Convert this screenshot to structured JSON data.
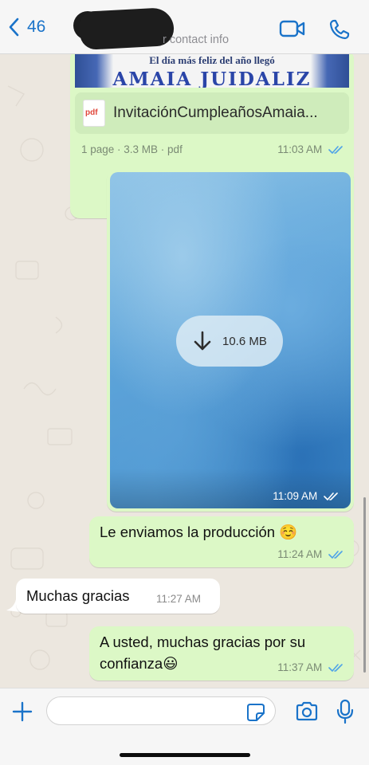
{
  "header": {
    "back_count": "46",
    "contact_name": "",
    "contact_subtitle": "r contact info"
  },
  "messages": {
    "pdf": {
      "preview_heading": "El día más feliz del año llegó",
      "preview_title": "AMAIA JUIDALIZ",
      "file_name": "InvitaciónCumpleañosAmaia...",
      "file_icon_label": "pdf",
      "info": "1 page · 3.3 MB · pdf",
      "time": "11:03 AM"
    },
    "image": {
      "download_size": "10.6 MB",
      "time": "11:09 AM"
    },
    "m1": {
      "text": "Le enviamos la producción ☺️",
      "time": "11:24 AM"
    },
    "m2": {
      "text": "Muchas gracias",
      "time": "11:27 AM"
    },
    "m3": {
      "text_line1": "A usted, muchas gracias por su",
      "text_line2": "confianza😃",
      "time": "11:37 AM"
    }
  },
  "composer": {
    "value": "",
    "placeholder": ""
  },
  "colors": {
    "accent": "#1a73c9",
    "outgoing_bubble": "#dcf8c6",
    "incoming_bubble": "#ffffff",
    "read_ticks": "#4fa3e8"
  },
  "icons": [
    "chevron-left-icon",
    "video-icon",
    "phone-icon",
    "pdf-file-icon",
    "download-arrow-icon",
    "double-check-icon",
    "plus-icon",
    "sticker-icon",
    "camera-icon",
    "microphone-icon"
  ]
}
